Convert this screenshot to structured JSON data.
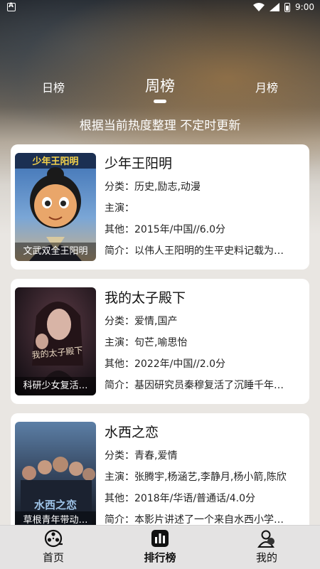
{
  "status_bar": {
    "time": "9:00"
  },
  "tabs": [
    {
      "label": "日榜"
    },
    {
      "label": "周榜"
    },
    {
      "label": "月榜"
    }
  ],
  "subtitle": "根据当前热度整理 不定时更新",
  "movies": [
    {
      "title": "少年王阳明",
      "poster_caption": "文武双全王阳明",
      "poster_top_text": "少年王阳明",
      "category": "分类：历史,励志,动漫",
      "cast": "主演：",
      "other": "其他：2015年/中国//6.0分",
      "intro": "简介：以伟人王阳明的生平史料记载为…"
    },
    {
      "title": "我的太子殿下",
      "poster_caption": "科研少女复活…",
      "poster_top_text": "",
      "category": "分类：爱情,国产",
      "cast": "主演：句芒,喻思怡",
      "other": "其他：2022年/中国//2.0分",
      "intro": "简介：基因研究员秦穆复活了沉睡千年…"
    },
    {
      "title": "水西之恋",
      "poster_caption": "草根青年带动…",
      "poster_top_text": "",
      "category": "分类：青春,爱情",
      "cast": "主演：张腾宇,杨涵艺,李静月,杨小箭,陈欣",
      "other": "其他：2018年/华语/普通话/4.0分",
      "intro": "简介：本影片讲述了一个来自水西小学…"
    }
  ],
  "bottom_nav": [
    {
      "label": "首页",
      "icon": "film-reel-icon"
    },
    {
      "label": "排行榜",
      "icon": "ranking-bars-icon"
    },
    {
      "label": "我的",
      "icon": "profile-icon"
    }
  ]
}
